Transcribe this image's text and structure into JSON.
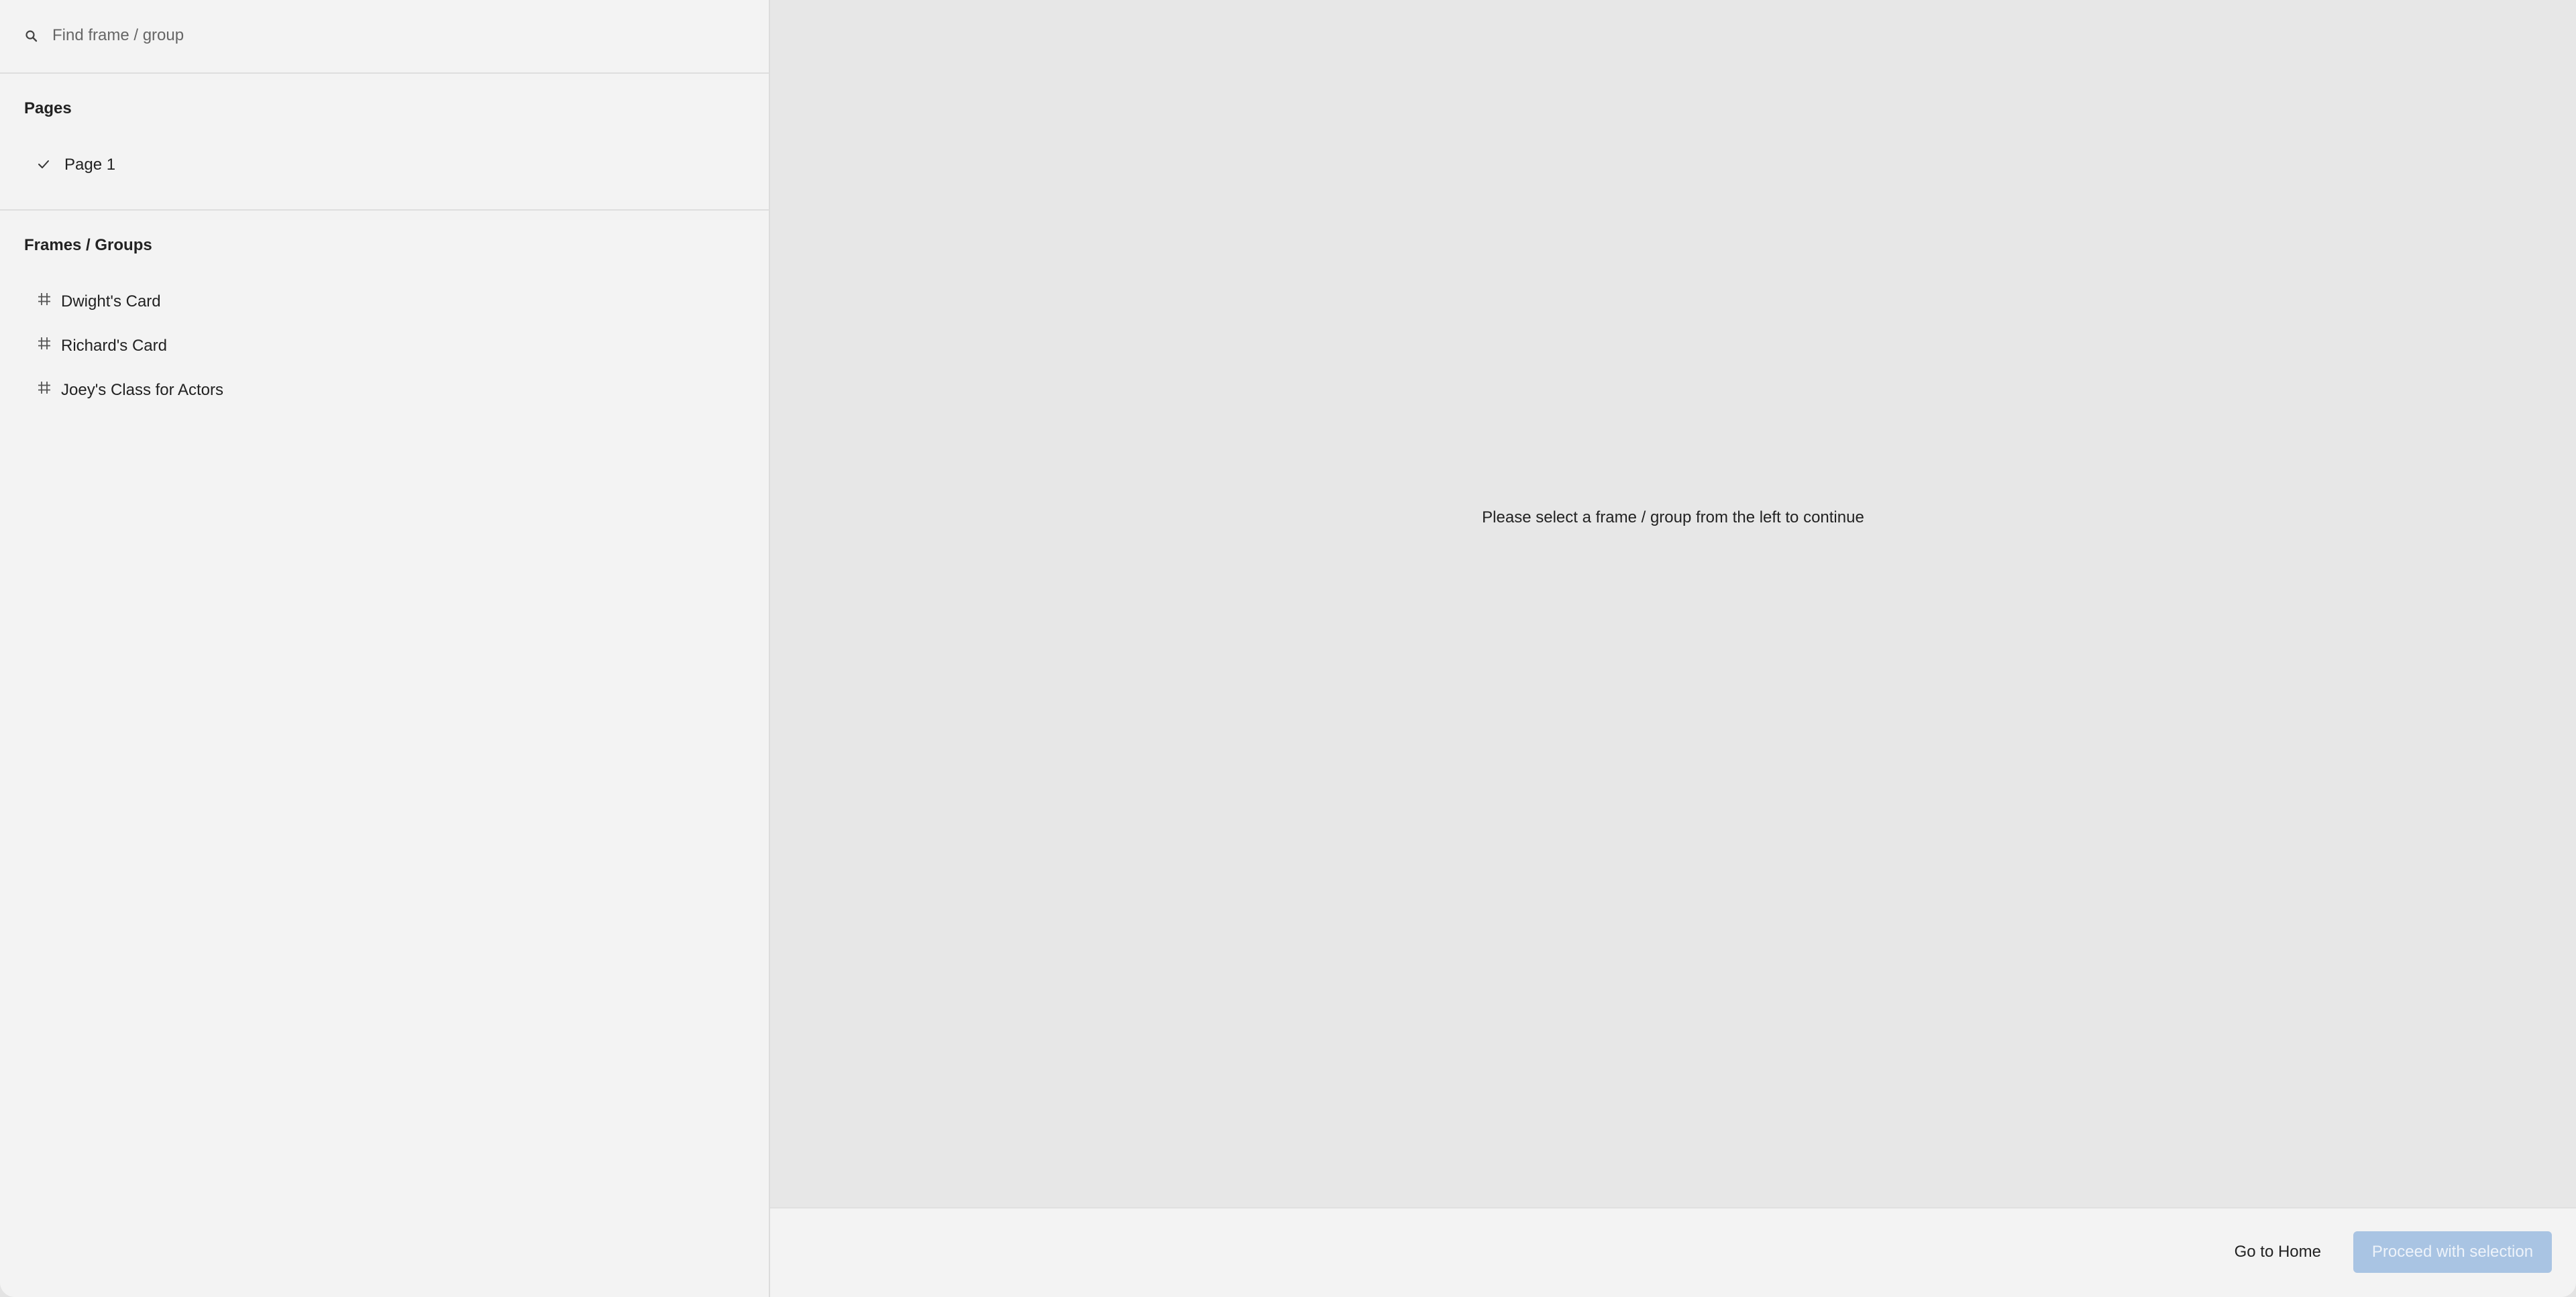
{
  "search": {
    "placeholder": "Find frame / group",
    "value": ""
  },
  "pages": {
    "title": "Pages",
    "items": [
      {
        "label": "Page 1",
        "selected": true,
        "icon": "check-icon"
      }
    ]
  },
  "frames": {
    "title": "Frames / Groups",
    "items": [
      {
        "label": "Dwight's Card",
        "icon": "hash-icon"
      },
      {
        "label": "Richard's Card",
        "icon": "hash-icon"
      },
      {
        "label": "Joey's Class for Actors",
        "icon": "hash-icon"
      }
    ]
  },
  "main": {
    "empty_message": "Please select a frame / group from the left to continue"
  },
  "footer": {
    "home_label": "Go to Home",
    "proceed_label": "Proceed with selection",
    "proceed_disabled": true
  },
  "colors": {
    "accent_disabled": "#a9c4e3",
    "sidebar_bg": "#f3f3f3",
    "main_bg": "#e7e7e7"
  }
}
